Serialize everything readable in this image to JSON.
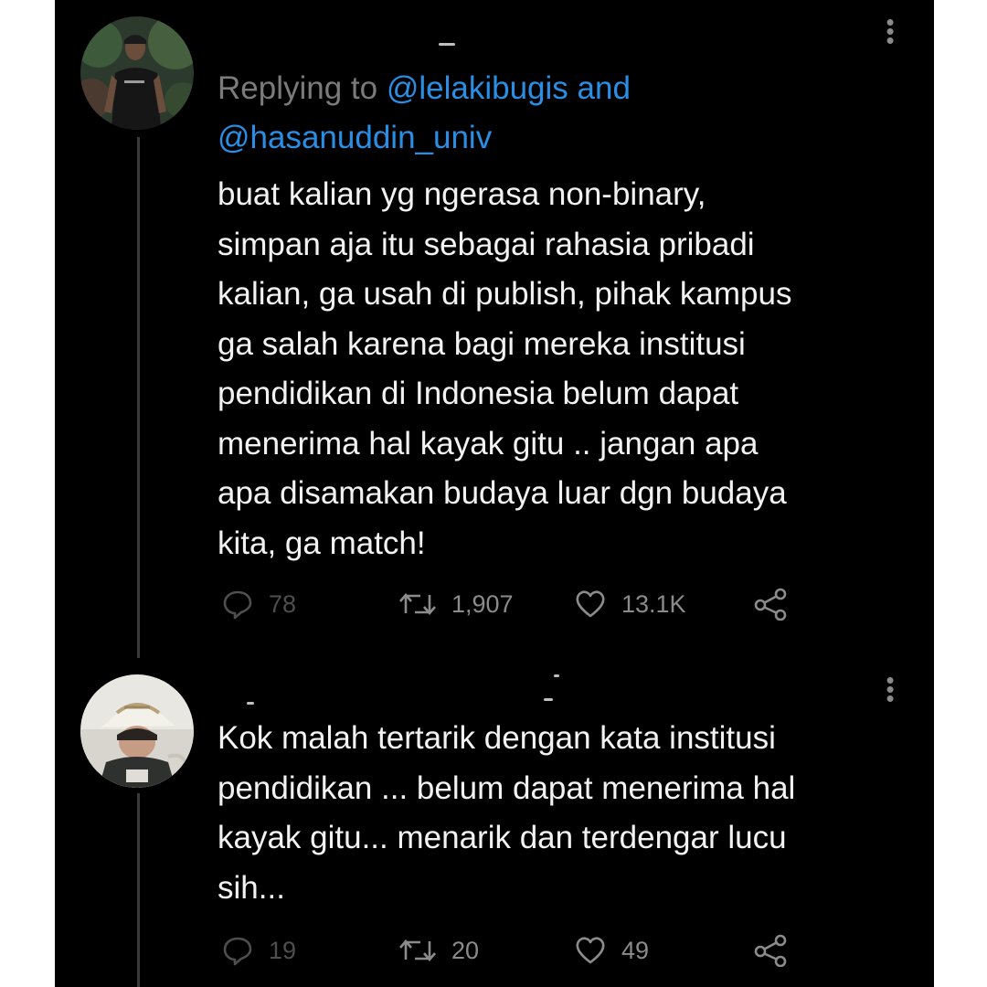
{
  "tweets": [
    {
      "reply_prefix": "Replying to ",
      "mention_1": "@lelakibugis",
      "mention_joiner": " and",
      "mention_2": "@hasanuddin_univ",
      "text_lines": [
        "buat kalian yg ngerasa non-binary,",
        "simpan aja itu sebagai rahasia pribadi",
        "kalian, ga usah di publish, pihak kampus",
        "ga salah karena bagi mereka institusi",
        "pendidikan di Indonesia belum dapat",
        "menerima hal kayak gitu .. jangan apa",
        "apa disamakan budaya luar dgn budaya",
        "kita, ga match!"
      ],
      "replies": "78",
      "retweets": "1,907",
      "likes": "13.1K",
      "icons": {
        "reply": "comment-bubble-icon",
        "retweet": "retweet-arrows-icon",
        "like": "heart-icon",
        "share": "share-nodes-icon",
        "more": "vertical-ellipsis-icon"
      }
    },
    {
      "text_lines": [
        "Kok malah tertarik dengan kata institusi",
        "pendidikan ... belum dapat menerima hal",
        "kayak gitu... menarik dan terdengar lucu",
        "sih..."
      ],
      "replies": "19",
      "retweets": "20",
      "likes": "49"
    }
  ],
  "colors": {
    "background": "#000000",
    "text": "#f2f2f2",
    "muted": "#8b8b8b",
    "mention": "#2a8fe4"
  }
}
